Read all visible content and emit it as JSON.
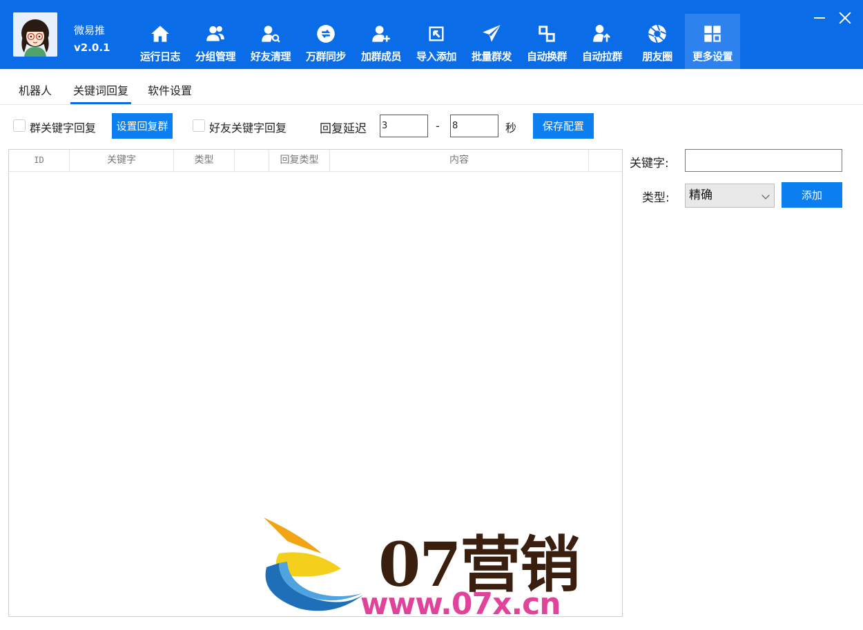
{
  "app": {
    "name": "微易推",
    "version": "v2.0.1"
  },
  "colors": {
    "header": "#0b6ce8",
    "accent": "#0b7ef0",
    "active_nav": "#2e82ee"
  },
  "nav": [
    {
      "label": "运行日志",
      "icon": "home-icon"
    },
    {
      "label": "分组管理",
      "icon": "users-icon"
    },
    {
      "label": "好友清理",
      "icon": "user-search-icon"
    },
    {
      "label": "万群同步",
      "icon": "sync-icon"
    },
    {
      "label": "加群成员",
      "icon": "user-add-icon"
    },
    {
      "label": "导入添加",
      "icon": "import-icon"
    },
    {
      "label": "批量群发",
      "icon": "send-icon"
    },
    {
      "label": "自动换群",
      "icon": "switch-icon"
    },
    {
      "label": "自动拉群",
      "icon": "user-up-icon"
    },
    {
      "label": "朋友圈",
      "icon": "aperture-icon"
    },
    {
      "label": "更多设置",
      "icon": "grid-icon",
      "active": true
    }
  ],
  "tabs": [
    "机器人",
    "关键词回复",
    "软件设置"
  ],
  "active_tab": "关键词回复",
  "toolbar": {
    "group_keyword_reply": "群关键字回复",
    "set_reply_group": "设置回复群",
    "friend_keyword_reply": "好友关键字回复",
    "reply_delay_label": "回复延迟",
    "delay_min": "3",
    "delay_separator": "-",
    "delay_max": "8",
    "seconds_unit": "秒",
    "save_config": "保存配置"
  },
  "table": {
    "columns": [
      "ID",
      "关键字",
      "类型",
      "",
      "回复类型",
      "内容"
    ],
    "rows": []
  },
  "right_panel": {
    "keyword_label": "关键字:",
    "keyword_value": "",
    "type_label": "类型:",
    "type_selected": "精确",
    "add_button": "添加"
  },
  "watermark": {
    "brand": "07营销",
    "url": "www.07x.cn"
  }
}
